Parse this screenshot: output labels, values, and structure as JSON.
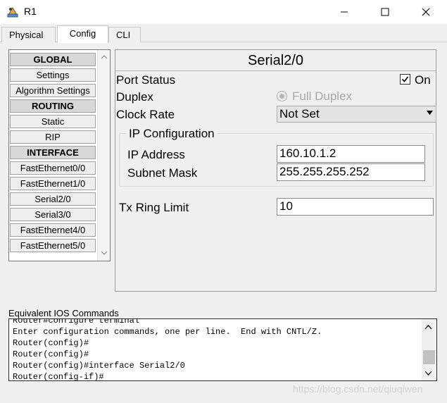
{
  "window": {
    "title": "R1"
  },
  "tabs": [
    {
      "label": "Physical",
      "active": false
    },
    {
      "label": "Config",
      "active": true
    },
    {
      "label": "CLI",
      "active": false
    }
  ],
  "nav": {
    "items": [
      {
        "label": "GLOBAL",
        "header": true
      },
      {
        "label": "Settings",
        "header": false
      },
      {
        "label": "Algorithm Settings",
        "header": false
      },
      {
        "label": "ROUTING",
        "header": true
      },
      {
        "label": "Static",
        "header": false
      },
      {
        "label": "RIP",
        "header": false
      },
      {
        "label": "INTERFACE",
        "header": true
      },
      {
        "label": "FastEthernet0/0",
        "header": false
      },
      {
        "label": "FastEthernet1/0",
        "header": false
      },
      {
        "label": "Serial2/0",
        "header": false
      },
      {
        "label": "Serial3/0",
        "header": false
      },
      {
        "label": "FastEthernet4/0",
        "header": false
      },
      {
        "label": "FastEthernet5/0",
        "header": false
      }
    ]
  },
  "config": {
    "title": "Serial2/0",
    "port_status": {
      "label": "Port Status",
      "checked": true,
      "check_label": "On"
    },
    "duplex": {
      "label": "Duplex",
      "option": "Full Duplex"
    },
    "clock_rate": {
      "label": "Clock Rate",
      "value": "Not Set"
    },
    "ip_config": {
      "legend": "IP Configuration",
      "ip_address": {
        "label": "IP Address",
        "value": "160.10.1.2"
      },
      "subnet_mask": {
        "label": "Subnet Mask",
        "value": "255.255.255.252"
      }
    },
    "tx_ring": {
      "label": "Tx Ring Limit",
      "value": "10"
    }
  },
  "ios": {
    "label": "Equivalent IOS Commands",
    "lines": [
      "Router#configure terminal",
      "Enter configuration commands, one per line.  End with CNTL/Z.",
      "Router(config)#",
      "Router(config)#",
      "Router(config)#interface Serial2/0",
      "Router(config-if)#"
    ]
  },
  "watermark": "https://blog.csdn.net/qiuqiwen",
  "colors": {
    "window_bg": "#f0f0f0",
    "panel_border": "#9a9a9a",
    "header_bg": "#d8d8d8",
    "disabled_text": "#a8a8a8"
  }
}
